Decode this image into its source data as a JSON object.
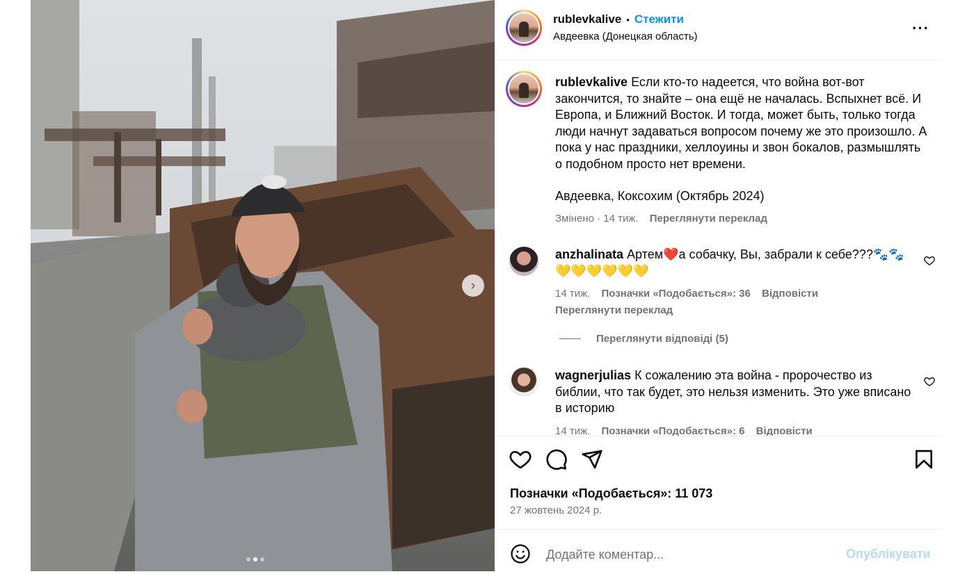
{
  "post": {
    "author": "rublevkalive",
    "follow_label": "Стежити",
    "separator": "•",
    "location": "Авдеевка (Донецкая область)",
    "more_icon": "more-icon",
    "more_label": "···"
  },
  "caption": {
    "username": "rublevkalive",
    "text": "Если кто-то надеется, что война вот-вот закончится, то знайте – она ещё не началась. Вспыхнет всё. И Европа, и Ближний Восток. И тогда, может быть, только тогда люди начнут задаваться вопросом почему же это произошло. А пока у нас праздники, хеллоуины и звон бокалов, размышлять о подобном просто нет времени.",
    "place_line": "Авдеевка, Коксохим (Октябрь 2024)",
    "edited": "Змінено · 14 тиж.",
    "see_translation": "Переглянути переклад"
  },
  "comments": [
    {
      "username": "anzhalinata",
      "text": "Артем❤️а собачку, Вы, забрали к себе???🐾🐾💛💛💛💛💛💛",
      "age": "14 тиж.",
      "likes": "Позначки «Подобається»: 36",
      "reply": "Відповісти",
      "see_translation": "Переглянути переклад",
      "view_replies": "Переглянути відповіді (5)"
    },
    {
      "username": "wagnerjulias",
      "text": "К сожалению эта война - пророчество из библии, что так будет, это нельзя изменить. Это уже вписано в историю",
      "age": "14 тиж.",
      "likes": "Позначки «Подобається»: 6",
      "reply": "Відповісти"
    }
  ],
  "engagement": {
    "likes": "Позначки «Подобається»: 11 073",
    "date": "27 жовтень 2024 р."
  },
  "composer": {
    "placeholder": "Додайте коментар...",
    "publish": "Опублікувати"
  },
  "carousel": {
    "next_icon": "chevron-right-icon",
    "next_glyph": "›",
    "slide_count": 3,
    "active_index": 1
  },
  "colors": {
    "link": "#0095f6",
    "muted": "#737373",
    "publish_disabled": "#b3dbff"
  }
}
